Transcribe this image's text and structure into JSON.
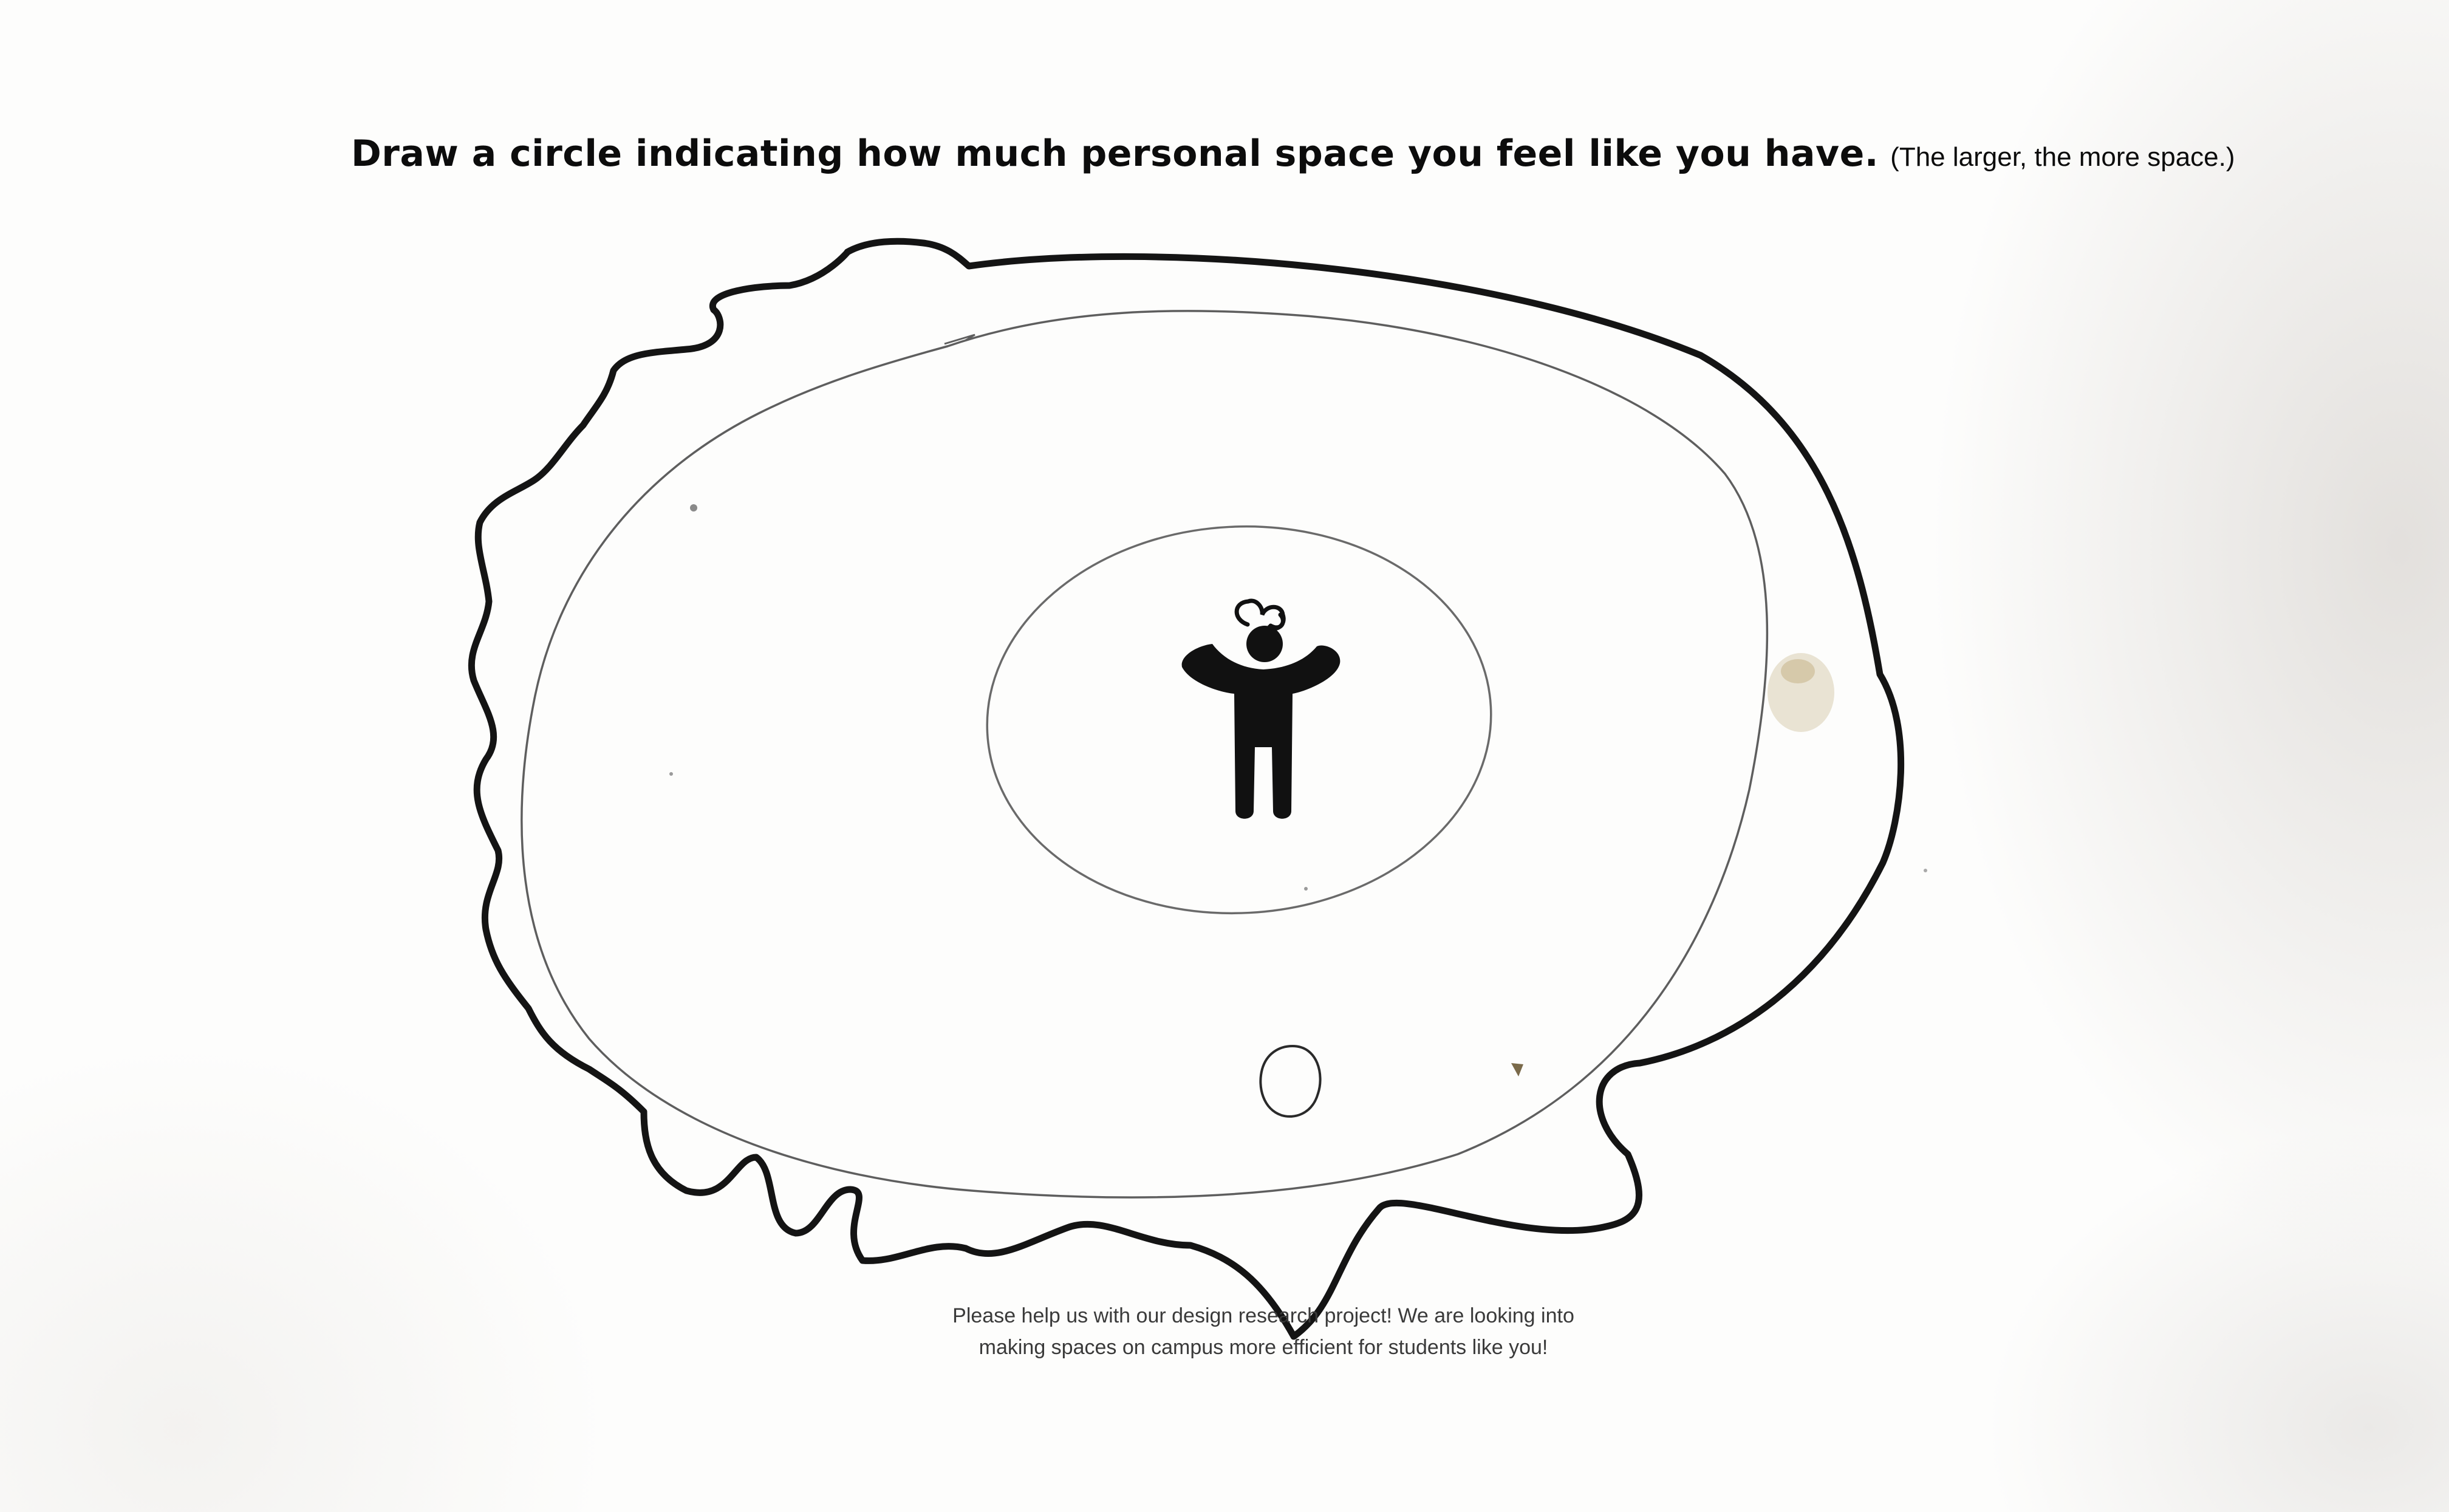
{
  "prompt": {
    "main": "Draw a circle indicating how much personal space you feel like you have.",
    "aside": "(The larger, the more space.)"
  },
  "footer": {
    "line1": "Please help us with our design research project! We are looking into",
    "line2": "making spaces on campus more efficient for students like you!"
  },
  "icons": {
    "figure": "person-figure-icon"
  },
  "colors": {
    "ink": "#111111",
    "pencil": "#6a6a6a",
    "paper": "#fdfdfc"
  }
}
